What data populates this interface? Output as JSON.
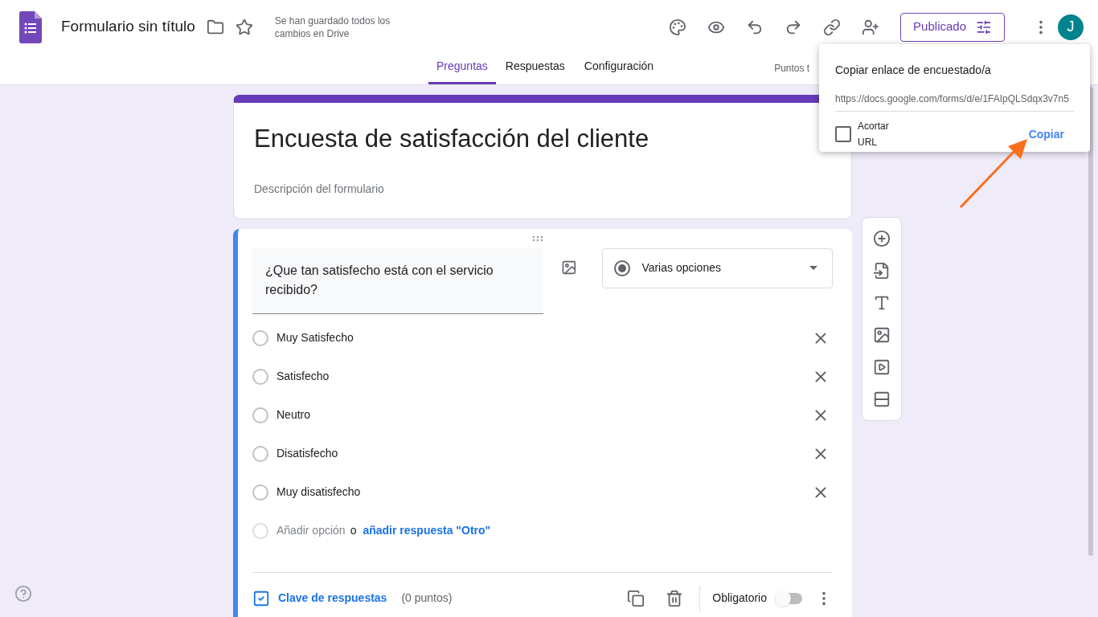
{
  "header": {
    "title": "Formulario sin título",
    "save_status": "Se han guardado todos los cambios en Drive",
    "publish_button": "Publicado",
    "avatar": "J"
  },
  "tabs": [
    {
      "label": "Preguntas",
      "selected": true
    },
    {
      "label": "Respuestas",
      "selected": false
    },
    {
      "label": "Configuración",
      "selected": false
    }
  ],
  "points_label": "Puntos t",
  "form": {
    "title": "Encuesta de satisfacción del cliente",
    "description": "Descripción del formulario"
  },
  "question": {
    "text": "¿Que tan satisfecho está con el servicio recibido?",
    "type": "Varias opciones",
    "options": [
      {
        "label": "Muy Satisfecho"
      },
      {
        "label": "Satisfecho"
      },
      {
        "label": "Neutro"
      },
      {
        "label": "Disatisfecho"
      },
      {
        "label": "Muy disatisfecho"
      }
    ],
    "add_option": "Añadir opción",
    "or": "o",
    "add_other": "añadir respuesta \"Otro\"",
    "answer_key": "Clave de respuestas",
    "points": "(0 puntos)",
    "required_label": "Obligatorio",
    "required": false
  },
  "popup": {
    "title": "Copiar enlace de encuestado/a",
    "url": "https://docs.google.com/forms/d/e/1FAIpQLSdqx3v7n5",
    "shorten_label_1": "Acortar",
    "shorten_label_2": "URL",
    "shorten": false,
    "copy_button": "Copiar"
  }
}
